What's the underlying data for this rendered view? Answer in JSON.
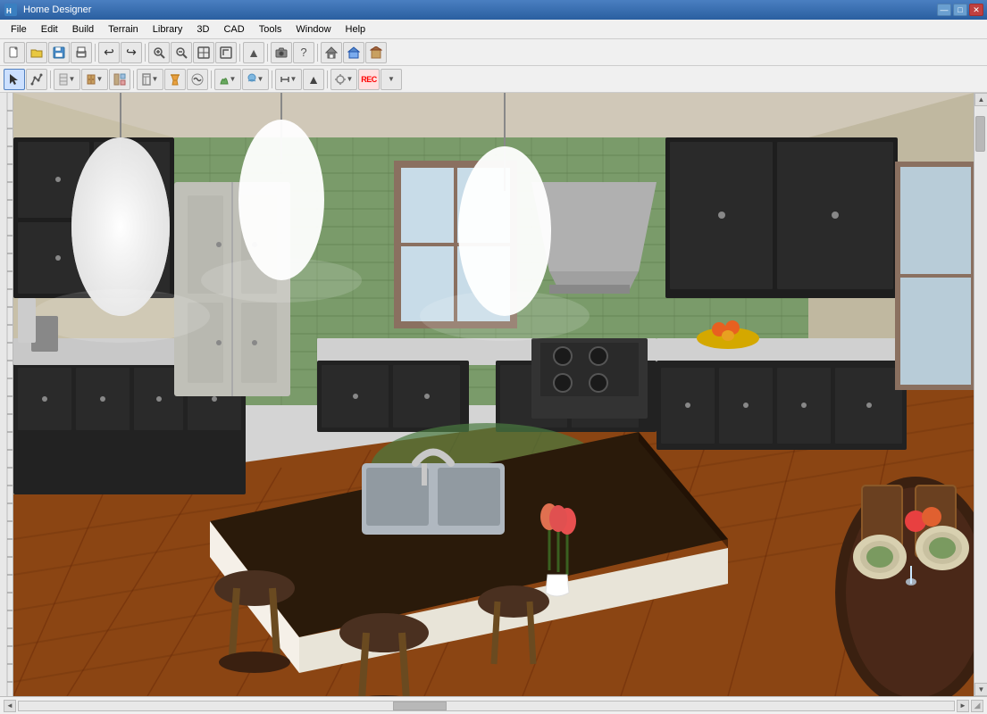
{
  "titleBar": {
    "title": "Home Designer",
    "icon": "HD",
    "controls": {
      "minimize": "—",
      "maximize": "□",
      "close": "✕"
    }
  },
  "menuBar": {
    "items": [
      {
        "id": "file",
        "label": "File"
      },
      {
        "id": "edit",
        "label": "Edit"
      },
      {
        "id": "build",
        "label": "Build"
      },
      {
        "id": "terrain",
        "label": "Terrain"
      },
      {
        "id": "library",
        "label": "Library"
      },
      {
        "id": "3d",
        "label": "3D"
      },
      {
        "id": "cad",
        "label": "CAD"
      },
      {
        "id": "tools",
        "label": "Tools"
      },
      {
        "id": "window",
        "label": "Window"
      },
      {
        "id": "help",
        "label": "Help"
      }
    ]
  },
  "toolbar1": {
    "buttons": [
      {
        "id": "new",
        "icon": "new-doc-icon",
        "tooltip": "New"
      },
      {
        "id": "open",
        "icon": "open-icon",
        "tooltip": "Open"
      },
      {
        "id": "save",
        "icon": "save-icon",
        "tooltip": "Save"
      },
      {
        "id": "print",
        "icon": "print-icon",
        "tooltip": "Print"
      },
      {
        "id": "undo",
        "icon": "undo-icon",
        "tooltip": "Undo"
      },
      {
        "id": "redo",
        "icon": "redo-icon",
        "tooltip": "Redo"
      },
      {
        "id": "zoom-in",
        "icon": "zoom-in-icon",
        "tooltip": "Zoom In"
      },
      {
        "id": "zoom-out",
        "icon": "zoom-out-icon",
        "tooltip": "Zoom Out"
      },
      {
        "id": "fit",
        "icon": "fit-icon",
        "tooltip": "Fit Page"
      },
      {
        "id": "ext",
        "icon": "ext-icon",
        "tooltip": "Extend"
      },
      {
        "id": "arrow-up",
        "icon": "arrow-up-icon",
        "tooltip": "Up"
      },
      {
        "id": "camera",
        "icon": "camera-icon",
        "tooltip": "Camera"
      },
      {
        "id": "question",
        "icon": "question-icon",
        "tooltip": "Help"
      },
      {
        "id": "house",
        "icon": "house-icon",
        "tooltip": "House"
      },
      {
        "id": "roof",
        "icon": "roof-icon",
        "tooltip": "Roof"
      },
      {
        "id": "garage",
        "icon": "garage-icon",
        "tooltip": "Garage"
      }
    ]
  },
  "toolbar2": {
    "buttons": [
      {
        "id": "select",
        "icon": "select-icon",
        "tooltip": "Select"
      },
      {
        "id": "polyline",
        "icon": "polyline-icon",
        "tooltip": "Polyline"
      },
      {
        "id": "measure",
        "icon": "measure-icon",
        "tooltip": "Measure"
      },
      {
        "id": "wall",
        "icon": "wall-icon",
        "tooltip": "Wall"
      },
      {
        "id": "cabinet",
        "icon": "cabinet-icon",
        "tooltip": "Cabinet"
      },
      {
        "id": "library-obj",
        "icon": "library-obj-icon",
        "tooltip": "Library Object"
      },
      {
        "id": "framing",
        "icon": "framing-icon",
        "tooltip": "Framing"
      },
      {
        "id": "paint",
        "icon": "paint-icon",
        "tooltip": "Paint"
      },
      {
        "id": "terrain-tool",
        "icon": "terrain-tool-icon",
        "tooltip": "Terrain"
      },
      {
        "id": "exterior",
        "icon": "exterior-icon",
        "tooltip": "Exterior"
      },
      {
        "id": "dimensions",
        "icon": "dimensions-icon",
        "tooltip": "Dimensions"
      },
      {
        "id": "record",
        "icon": "record-icon",
        "tooltip": "Record"
      }
    ]
  },
  "statusBar": {
    "info": ""
  }
}
